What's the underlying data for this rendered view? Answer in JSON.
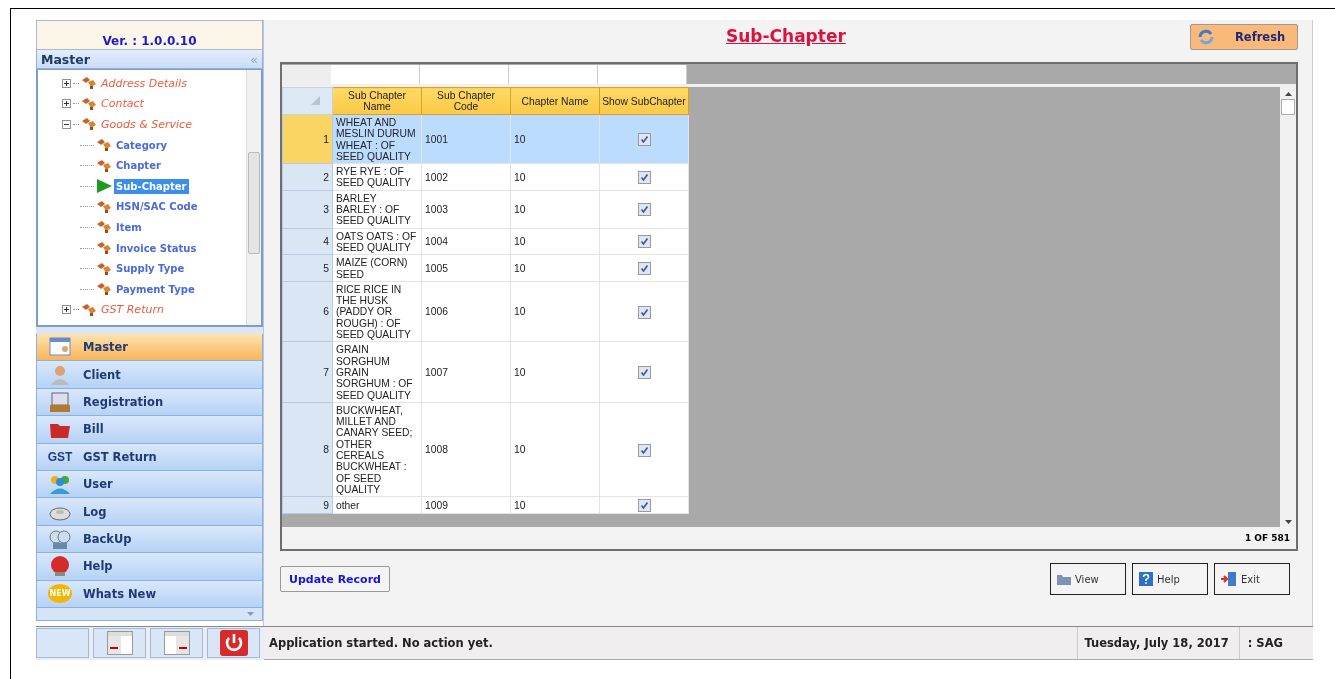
{
  "app_header": {
    "version": "Ver. : 1.0.0.10"
  },
  "sidebar": {
    "title": "Master",
    "collapse_glyph": "«",
    "tree": [
      {
        "label": "Address Details",
        "expanded": false,
        "selected": false
      },
      {
        "label": "Contact",
        "expanded": false,
        "selected": false
      },
      {
        "label": "Goods & Service",
        "expanded": true,
        "selected": false,
        "children": [
          {
            "label": "Category",
            "selected": false
          },
          {
            "label": "Chapter",
            "selected": false
          },
          {
            "label": "Sub-Chapter",
            "selected": true
          },
          {
            "label": "HSN/SAC Code",
            "selected": false
          },
          {
            "label": "Item",
            "selected": false
          },
          {
            "label": "Invoice Status",
            "selected": false
          },
          {
            "label": "Supply Type",
            "selected": false
          },
          {
            "label": "Payment Type",
            "selected": false
          }
        ]
      },
      {
        "label": "GST Return",
        "expanded": false,
        "selected": false
      }
    ],
    "nav": [
      {
        "label": "Master",
        "selected": true
      },
      {
        "label": "Client",
        "selected": false
      },
      {
        "label": "Registration",
        "selected": false
      },
      {
        "label": "Bill",
        "selected": false
      },
      {
        "label": "GST Return",
        "selected": false,
        "icon_text": "GST"
      },
      {
        "label": "User",
        "selected": false
      },
      {
        "label": "Log",
        "selected": false
      },
      {
        "label": "BackUp",
        "selected": false
      },
      {
        "label": "Help",
        "selected": false
      },
      {
        "label": "Whats New",
        "selected": false,
        "icon_text": "NEW"
      }
    ]
  },
  "page": {
    "title": "Sub-Chapter",
    "refresh_button": "Refresh"
  },
  "table": {
    "columns": [
      "Sub Chapter Name",
      "Sub Chapter Code",
      "Chapter Name",
      "Show SubChapter"
    ],
    "rows": [
      {
        "num": "1",
        "name": "WHEAT AND MESLIN DURUM WHEAT : OF SEED QUALITY",
        "code": "1001",
        "chapter": "10",
        "show": true,
        "selected": true
      },
      {
        "num": "2",
        "name": "RYE RYE : OF SEED QUALITY",
        "code": "1002",
        "chapter": "10",
        "show": true,
        "selected": false
      },
      {
        "num": "3",
        "name": "BARLEY BARLEY : OF SEED QUALITY",
        "code": "1003",
        "chapter": "10",
        "show": true,
        "selected": false
      },
      {
        "num": "4",
        "name": "OATS OATS : OF SEED QUALITY",
        "code": "1004",
        "chapter": "10",
        "show": true,
        "selected": false
      },
      {
        "num": "5",
        "name": "MAIZE (CORN) SEED",
        "code": "1005",
        "chapter": "10",
        "show": true,
        "selected": false
      },
      {
        "num": "6",
        "name": "RICE RICE IN THE HUSK (PADDY OR ROUGH) : OF SEED QUALITY",
        "code": "1006",
        "chapter": "10",
        "show": true,
        "selected": false
      },
      {
        "num": "7",
        "name": "GRAIN SORGHUM GRAIN SORGHUM : OF SEED QUALITY",
        "code": "1007",
        "chapter": "10",
        "show": true,
        "selected": false
      },
      {
        "num": "8",
        "name": "BUCKWHEAT, MILLET AND CANARY SEED; OTHER CEREALS BUCKWHEAT : OF SEED QUALITY",
        "code": "1008",
        "chapter": "10",
        "show": true,
        "selected": false
      },
      {
        "num": "9",
        "name": "other",
        "code": "1009",
        "chapter": "10",
        "show": true,
        "selected": false
      }
    ],
    "record_count": "1 OF 581"
  },
  "buttons": {
    "update": "Update Record",
    "view": "View",
    "help": "Help",
    "exit": "Exit"
  },
  "status_bar": {
    "message": "Application started. No action yet.",
    "date": "Tuesday, July 18, 2017",
    "user": ": SAG"
  }
}
